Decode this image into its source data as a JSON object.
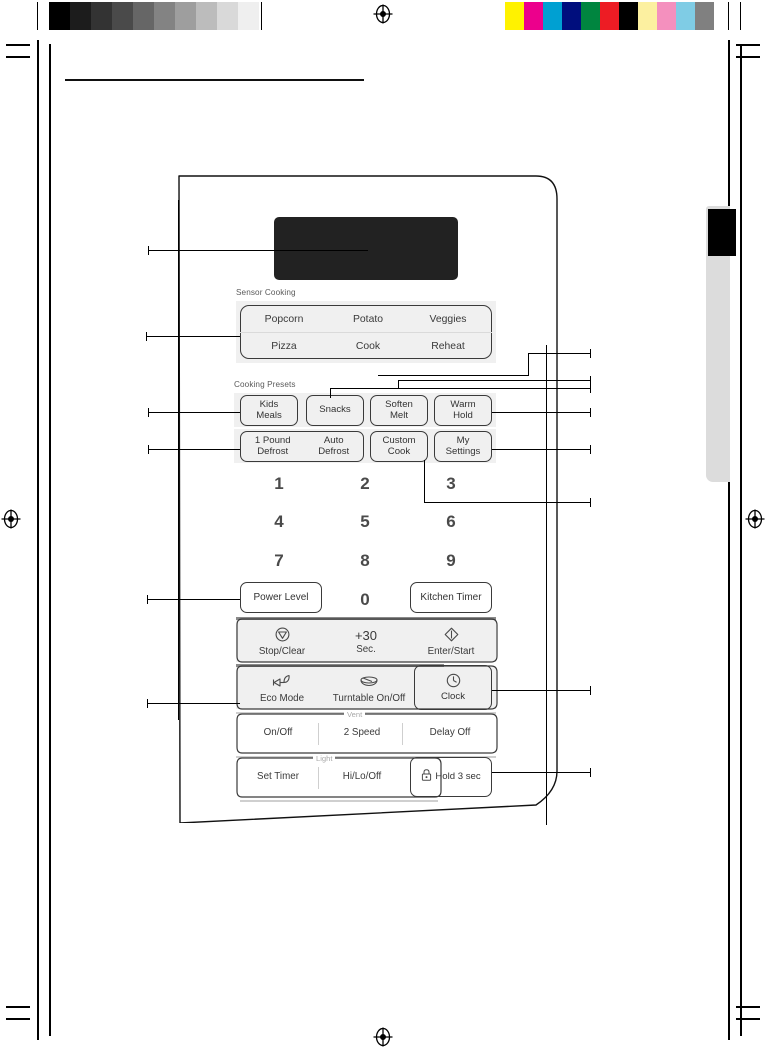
{
  "document": {
    "kind": "appliance-manual-page",
    "heading_rule_present": true
  },
  "calibration": {
    "grayscale_label": "grayscale-step-wedge",
    "grayscale_steps": [
      "#000000",
      "#1c1c1c",
      "#333333",
      "#4a4a4a",
      "#666666",
      "#838383",
      "#9e9e9e",
      "#bcbcbc",
      "#d9d9d9",
      "#efefef"
    ],
    "color_label": "process-color-bar",
    "color_steps": [
      "#fff200",
      "#ec008c",
      "#00a0d2",
      "#000e7d",
      "#00853f",
      "#ed1c24",
      "#000000",
      "#fcf0a0",
      "#f490be",
      "#7fcce5",
      "#808080"
    ],
    "registration_mark": "registration-target-icon"
  },
  "tab": {
    "name": "page-edge-section-tab",
    "strip_color": "#dcdcdc",
    "marker_color": "#000000"
  },
  "panel": {
    "title": "microwave-control-panel",
    "display": {
      "name": "led-display-window",
      "color": "#222222",
      "text": ""
    },
    "groups": [
      {
        "id": "sensor",
        "label": "Sensor Cooking"
      },
      {
        "id": "presets",
        "label": "Cooking Presets"
      }
    ],
    "sensor_cooking": {
      "row1": [
        "Popcorn",
        "Potato",
        "Veggies"
      ],
      "row2": [
        "Pizza",
        "Cook",
        "Reheat"
      ]
    },
    "cooking_presets": {
      "row1": [
        {
          "lines": [
            "Kids",
            "Meals"
          ],
          "boxed": true
        },
        {
          "lines": [
            "Snacks"
          ],
          "boxed": true
        },
        {
          "lines": [
            "Soften",
            "Melt"
          ],
          "boxed": true
        },
        {
          "lines": [
            "Warm",
            "Hold"
          ],
          "boxed": true
        }
      ],
      "row2": [
        {
          "lines": [
            "1 Pound",
            "Defrost"
          ],
          "boxed": true
        },
        {
          "lines": [
            "Auto",
            "Defrost"
          ],
          "boxed": false
        },
        {
          "lines": [
            "Custom",
            "Cook"
          ],
          "boxed": true
        },
        {
          "lines": [
            "My",
            "Settings"
          ],
          "boxed": true
        }
      ]
    },
    "keypad": {
      "digits": [
        "1",
        "2",
        "3",
        "4",
        "5",
        "6",
        "7",
        "8",
        "9",
        "0"
      ]
    },
    "function_keys": {
      "power_level": "Power Level",
      "kitchen_timer": "Kitchen Timer"
    },
    "action_row": {
      "stop_clear": {
        "label": "Stop/Clear",
        "icon": "stop-triangle-icon"
      },
      "add30": {
        "label": "Sec.",
        "big": "+30",
        "icon": "none"
      },
      "enter_start": {
        "label": "Enter/Start",
        "icon": "start-diamond-icon"
      }
    },
    "option_row": {
      "eco_mode": {
        "label": "Eco Mode",
        "icon": "eco-leaf-plug-icon"
      },
      "turntable": {
        "label": "Turntable On/Off",
        "icon": "turntable-plate-icon"
      },
      "clock": {
        "label": "Clock",
        "icon": "clock-face-icon",
        "boxed": true
      }
    },
    "vent_row": {
      "group_label": "Vent",
      "keys": [
        "On/Off",
        "2 Speed",
        "Delay Off"
      ]
    },
    "light_row": {
      "group_label": "Light",
      "keys": [
        "Set Timer",
        "Hi/Lo/Off"
      ],
      "lock": {
        "label": "Hold 3 sec",
        "icon": "padlock-icon",
        "boxed": true
      }
    }
  },
  "callouts": {
    "left": [
      {
        "target": "led-display-window"
      },
      {
        "target": "sensor-cooking-pad"
      },
      {
        "target": "kids-meals-key"
      },
      {
        "target": "one-pound-defrost-key"
      },
      {
        "target": "power-level-key"
      },
      {
        "target": "eco-mode-key"
      }
    ],
    "right": [
      {
        "target": "sensor-cooking-reheat"
      },
      {
        "target": "snacks-soften-melt"
      },
      {
        "target": "warm-hold-key"
      },
      {
        "target": "my-settings-key"
      },
      {
        "target": "custom-cook-key"
      },
      {
        "target": "clock-key"
      },
      {
        "target": "lock-hold-key"
      }
    ]
  }
}
